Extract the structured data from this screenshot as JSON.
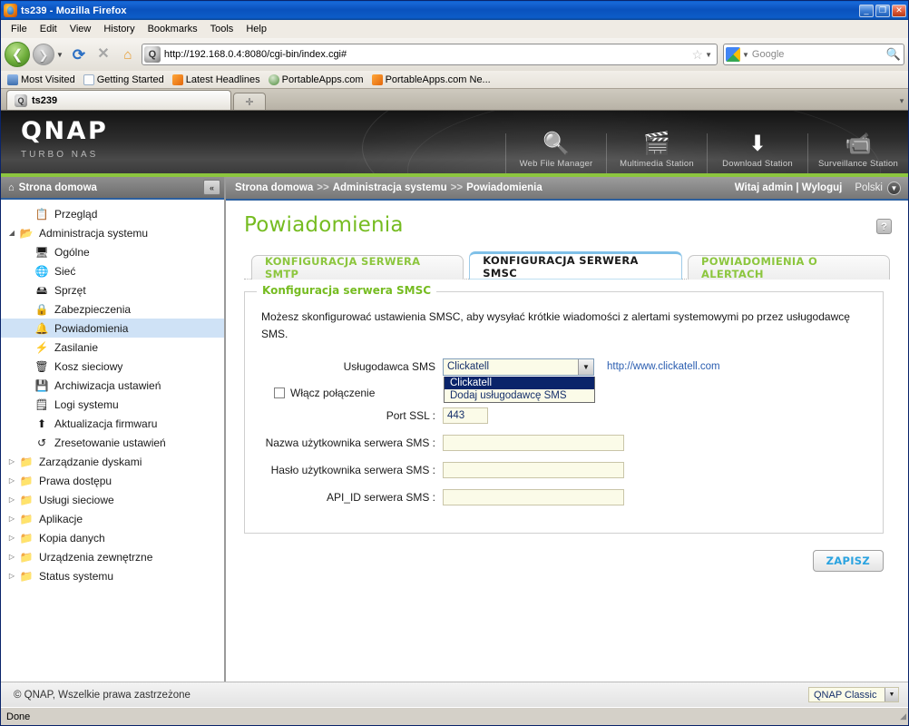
{
  "window": {
    "title": "ts239 - Mozilla Firefox",
    "minimize": "_",
    "maximize": "❐",
    "close": "✕"
  },
  "menu": [
    "File",
    "Edit",
    "View",
    "History",
    "Bookmarks",
    "Tools",
    "Help"
  ],
  "toolbar": {
    "back": "❮",
    "forward": "❯",
    "reload": "⟳",
    "stop": "✕",
    "home": "⌂",
    "url": "http://192.168.0.4:8080/cgi-bin/index.cgi#",
    "star": "☆",
    "dropdown": "▼",
    "search_placeholder": "Google",
    "search_value": "",
    "search_icon": "🔍"
  },
  "bookmarks": [
    {
      "label": "Most Visited",
      "icon": "most-visited-icon"
    },
    {
      "label": "Getting Started",
      "icon": "page-icon"
    },
    {
      "label": "Latest Headlines",
      "icon": "rss-icon"
    },
    {
      "label": "PortableApps.com",
      "icon": "portableapps-icon"
    },
    {
      "label": "PortableApps.com Ne...",
      "icon": "rss-icon"
    }
  ],
  "browser_tabs": {
    "active_tab": "ts239",
    "new_tab": "✛",
    "list_all": "▾"
  },
  "banner": {
    "logo": "QNAP",
    "tagline": "TURBO NAS",
    "stations": [
      {
        "label": "Web File Manager",
        "icon": "🔍"
      },
      {
        "label": "Multimedia Station",
        "icon": "🎬"
      },
      {
        "label": "Download Station",
        "icon": "⬇"
      },
      {
        "label": "Surveillance Station",
        "icon": "📹"
      }
    ]
  },
  "sidebar": {
    "header": "Strona domowa",
    "header_icon": "⌂",
    "collapse_icon": "«",
    "items": [
      {
        "label": "Przegląd",
        "level": 1,
        "twisty": "",
        "icon": "📋",
        "selected": false
      },
      {
        "label": "Administracja systemu",
        "level": 0,
        "twisty": "◢",
        "icon": "📂",
        "selected": false
      },
      {
        "label": "Ogólne",
        "level": 1,
        "twisty": "",
        "icon": "🖥",
        "selected": false
      },
      {
        "label": "Sieć",
        "level": 1,
        "twisty": "",
        "icon": "🌐",
        "selected": false
      },
      {
        "label": "Sprzęt",
        "level": 1,
        "twisty": "",
        "icon": "🖴",
        "selected": false
      },
      {
        "label": "Zabezpieczenia",
        "level": 1,
        "twisty": "",
        "icon": "🔒",
        "selected": false
      },
      {
        "label": "Powiadomienia",
        "level": 1,
        "twisty": "",
        "icon": "🔔",
        "selected": true
      },
      {
        "label": "Zasilanie",
        "level": 1,
        "twisty": "",
        "icon": "⚡",
        "selected": false
      },
      {
        "label": "Kosz sieciowy",
        "level": 1,
        "twisty": "",
        "icon": "🗑",
        "selected": false
      },
      {
        "label": "Archiwizacja ustawień",
        "level": 1,
        "twisty": "",
        "icon": "💾",
        "selected": false
      },
      {
        "label": "Logi systemu",
        "level": 1,
        "twisty": "",
        "icon": "🗒",
        "selected": false
      },
      {
        "label": "Aktualizacja firmwaru",
        "level": 1,
        "twisty": "",
        "icon": "⬆",
        "selected": false
      },
      {
        "label": "Zresetowanie ustawień",
        "level": 1,
        "twisty": "",
        "icon": "↺",
        "selected": false
      },
      {
        "label": "Zarządzanie dyskami",
        "level": 0,
        "twisty": "▷",
        "icon": "📁",
        "selected": false
      },
      {
        "label": "Prawa dostępu",
        "level": 0,
        "twisty": "▷",
        "icon": "📁",
        "selected": false
      },
      {
        "label": "Usługi sieciowe",
        "level": 0,
        "twisty": "▷",
        "icon": "📁",
        "selected": false
      },
      {
        "label": "Aplikacje",
        "level": 0,
        "twisty": "▷",
        "icon": "📁",
        "selected": false
      },
      {
        "label": "Kopia danych",
        "level": 0,
        "twisty": "▷",
        "icon": "📁",
        "selected": false
      },
      {
        "label": "Urządzenia zewnętrzne",
        "level": 0,
        "twisty": "▷",
        "icon": "📁",
        "selected": false
      },
      {
        "label": "Status systemu",
        "level": 0,
        "twisty": "▷",
        "icon": "📁",
        "selected": false
      }
    ]
  },
  "breadcrumb": {
    "parts": [
      "Strona domowa",
      "Administracja systemu",
      "Powiadomienia"
    ],
    "separator": ">>",
    "greeting": "Witaj admin | Wyloguj",
    "language": "Polski",
    "language_arrow": "▼"
  },
  "main": {
    "title": "Powiadomienia",
    "help_icon": "?",
    "tabs": [
      {
        "label": "KONFIGURACJA SERWERA SMTP",
        "active": false
      },
      {
        "label": "KONFIGURACJA SERWERA SMSC",
        "active": true
      },
      {
        "label": "POWIADOMIENIA O ALERTACH",
        "active": false
      }
    ],
    "panel": {
      "legend": "Konfiguracja serwera SMSC",
      "description": "Możesz skonfigurować ustawienia SMSC, aby wysyłać krótkie wiadomości z alertami systemowymi po przez usługodawcę SMS.",
      "provider_label": "Usługodawca SMS",
      "provider_value": "Clickatell",
      "provider_arrow": "▼",
      "provider_options": [
        "Clickatell",
        "Dodaj usługodawcę SMS"
      ],
      "provider_selected_index": 0,
      "provider_link": "http://www.clickatell.com",
      "ssl_checkbox_label": "Włącz połączenie",
      "ssl_checked": false,
      "fields": [
        {
          "label": "Port SSL :",
          "value": "443",
          "width": "w50"
        },
        {
          "label": "Nazwa użytkownika serwera SMS :",
          "value": "",
          "width": "w200"
        },
        {
          "label": "Hasło użytkownika serwera SMS :",
          "value": "",
          "width": "w200"
        },
        {
          "label": "API_ID serwera SMS :",
          "value": "",
          "width": "w200"
        }
      ]
    },
    "save_label": "ZAPISZ"
  },
  "page_footer": {
    "copyright": "© QNAP, Wszelkie prawa zastrzeżone",
    "theme": "QNAP Classic",
    "theme_arrow": "▼"
  },
  "status": {
    "text": "Done"
  },
  "colors": {
    "accent_green": "#8cc63e",
    "title_green": "#76bc21",
    "link_blue": "#2a5db0",
    "save_blue": "#2aa3e0",
    "select_highlight": "#0a246a",
    "sidebar_selected": "#cfe2f6"
  }
}
